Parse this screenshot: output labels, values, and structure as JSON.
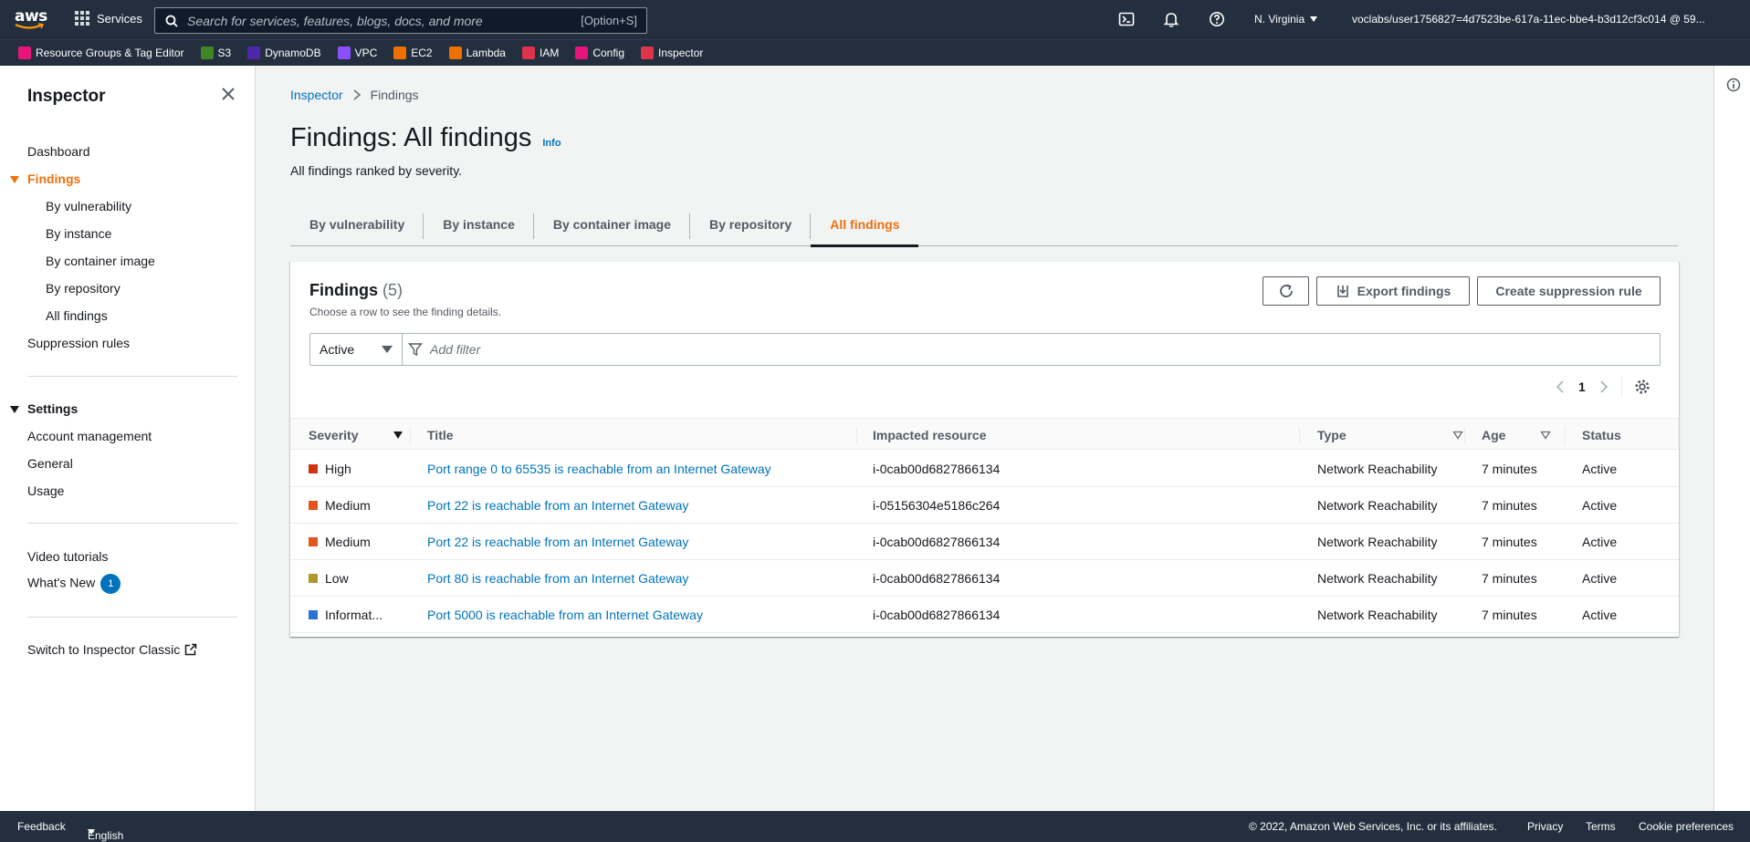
{
  "topnav": {
    "logo_text": "aws",
    "services_label": "Services",
    "search_placeholder": "Search for services, features, blogs, docs, and more",
    "search_shortcut": "[Option+S]",
    "region": "N. Virginia",
    "account": "voclabs/user1756827=4d7523be-617a-11ec-bbe4-b3d12cf3c014 @ 59..."
  },
  "favorites": [
    {
      "label": "Resource Groups & Tag Editor",
      "color": "#e7157b"
    },
    {
      "label": "S3",
      "color": "#3f8624"
    },
    {
      "label": "DynamoDB",
      "color": "#4d27aa"
    },
    {
      "label": "VPC",
      "color": "#8c4fff"
    },
    {
      "label": "EC2",
      "color": "#ed7100"
    },
    {
      "label": "Lambda",
      "color": "#ed7100"
    },
    {
      "label": "IAM",
      "color": "#dd344c"
    },
    {
      "label": "Config",
      "color": "#e7157b"
    },
    {
      "label": "Inspector",
      "color": "#dd344c"
    }
  ],
  "sidebar": {
    "title": "Inspector",
    "dashboard": "Dashboard",
    "findings": "Findings",
    "findings_items": [
      "By vulnerability",
      "By instance",
      "By container image",
      "By repository",
      "All findings"
    ],
    "suppression": "Suppression rules",
    "settings": "Settings",
    "settings_items": [
      "Account management",
      "General",
      "Usage"
    ],
    "video": "Video tutorials",
    "whats_new": "What's New",
    "whats_new_count": "1",
    "classic": "Switch to Inspector Classic"
  },
  "breadcrumb": {
    "root": "Inspector",
    "current": "Findings"
  },
  "page": {
    "title": "Findings: All findings",
    "info": "Info",
    "subtitle": "All findings ranked by severity."
  },
  "tabs": [
    "By vulnerability",
    "By instance",
    "By container image",
    "By repository",
    "All findings"
  ],
  "panel": {
    "title": "Findings",
    "count": "(5)",
    "description": "Choose a row to see the finding details.",
    "export_label": "Export findings",
    "create_label": "Create suppression rule",
    "filter_status": "Active",
    "filter_placeholder": "Add filter",
    "page_number": "1"
  },
  "table": {
    "headers": {
      "severity": "Severity",
      "title": "Title",
      "resource": "Impacted resource",
      "type": "Type",
      "age": "Age",
      "status": "Status"
    },
    "rows": [
      {
        "severity": "High",
        "color": "#d13212",
        "title": "Port range 0 to 65535 is reachable from an Internet Gateway",
        "resource": "i-0cab00d6827866134",
        "type": "Network Reachability",
        "age": "7 minutes",
        "status": "Active"
      },
      {
        "severity": "Medium",
        "color": "#e3571d",
        "title": "Port 22 is reachable from an Internet Gateway",
        "resource": "i-05156304e5186c264",
        "type": "Network Reachability",
        "age": "7 minutes",
        "status": "Active"
      },
      {
        "severity": "Medium",
        "color": "#e3571d",
        "title": "Port 22 is reachable from an Internet Gateway",
        "resource": "i-0cab00d6827866134",
        "type": "Network Reachability",
        "age": "7 minutes",
        "status": "Active"
      },
      {
        "severity": "Low",
        "color": "#b0972c",
        "title": "Port 80 is reachable from an Internet Gateway",
        "resource": "i-0cab00d6827866134",
        "type": "Network Reachability",
        "age": "7 minutes",
        "status": "Active"
      },
      {
        "severity": "Informat...",
        "color": "#2b73d3",
        "title": "Port 5000 is reachable from an Internet Gateway",
        "resource": "i-0cab00d6827866134",
        "type": "Network Reachability",
        "age": "7 minutes",
        "status": "Active"
      }
    ]
  },
  "footer": {
    "feedback": "Feedback",
    "language": "English (US)",
    "copyright": "© 2022, Amazon Web Services, Inc. or its affiliates.",
    "privacy": "Privacy",
    "terms": "Terms",
    "cookies": "Cookie preferences"
  }
}
